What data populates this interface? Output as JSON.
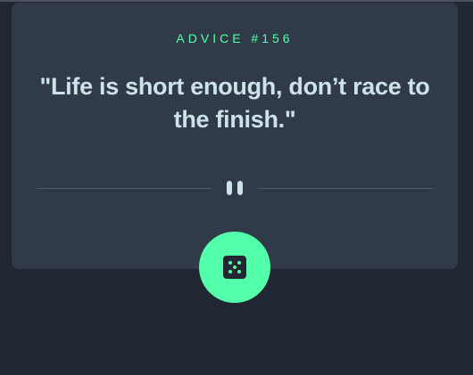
{
  "advice": {
    "label": "ADVICE #156",
    "quote": "\"Life is short enough, don’t race to the finish.\""
  },
  "icons": {
    "divider": "pause-icon",
    "button": "dice-icon"
  },
  "colors": {
    "background": "#202733",
    "card": "#313a48",
    "accent": "#53ffaa",
    "text": "#cee3e9",
    "divider": "#4f5b69"
  }
}
